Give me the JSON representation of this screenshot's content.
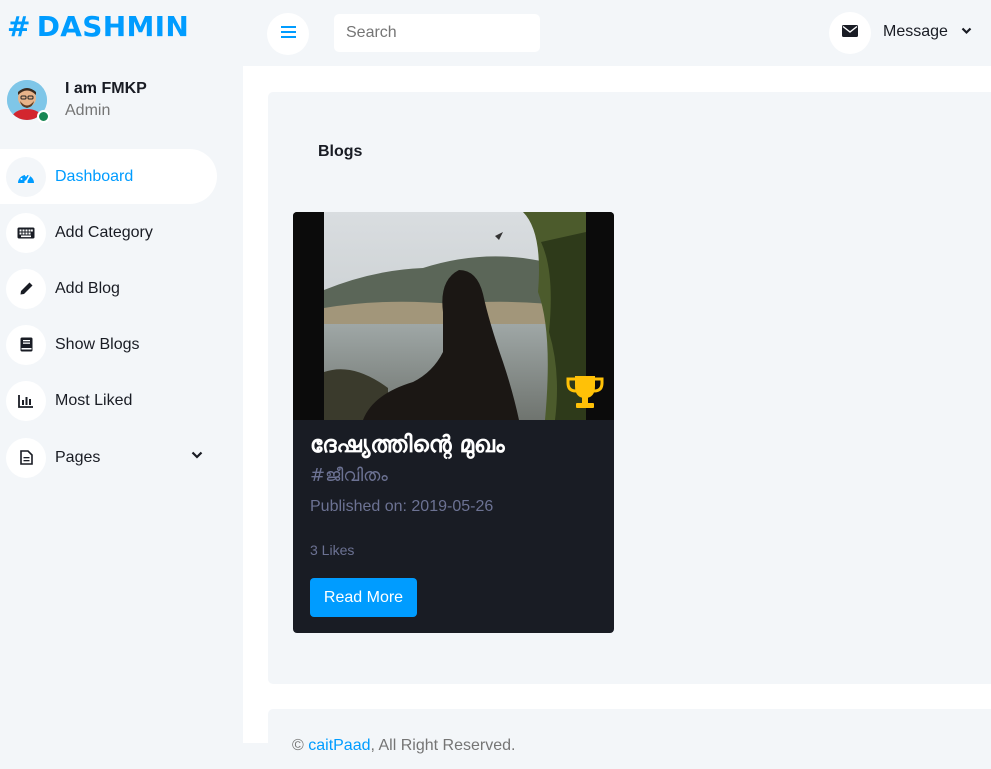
{
  "brand": {
    "hash": "#",
    "name": "DASHMIN"
  },
  "user": {
    "name": "I am FMKP",
    "role": "Admin"
  },
  "sidebar": {
    "items": [
      {
        "label": "Dashboard",
        "icon": "dashboard-gauge-icon",
        "active": true
      },
      {
        "label": "Add Category",
        "icon": "keyboard-icon"
      },
      {
        "label": "Add Blog",
        "icon": "pencil-icon"
      },
      {
        "label": "Show Blogs",
        "icon": "book-icon"
      },
      {
        "label": "Most Liked",
        "icon": "bar-chart-icon"
      },
      {
        "label": "Pages",
        "icon": "document-icon",
        "has_dropdown": true
      }
    ]
  },
  "topbar": {
    "search_placeholder": "Search",
    "message_label": "Message"
  },
  "main": {
    "heading": "Blogs",
    "blog_card": {
      "title": "ദേഷ്യത്തിന്റെ മുഖം",
      "tag": "#ജീവിതം",
      "published": "Published on: 2019-05-26",
      "likes": "3 Likes",
      "button_label": "Read More",
      "badge_icon": "trophy-icon"
    }
  },
  "footer": {
    "prefix": "© ",
    "link": "caitPaad",
    "suffix": ", All Right Reserved."
  },
  "colors": {
    "accent": "#009cff",
    "dark": "#191c24",
    "light_bg": "#f3f6f9",
    "trophy": "#ffc107",
    "online": "#198754"
  }
}
